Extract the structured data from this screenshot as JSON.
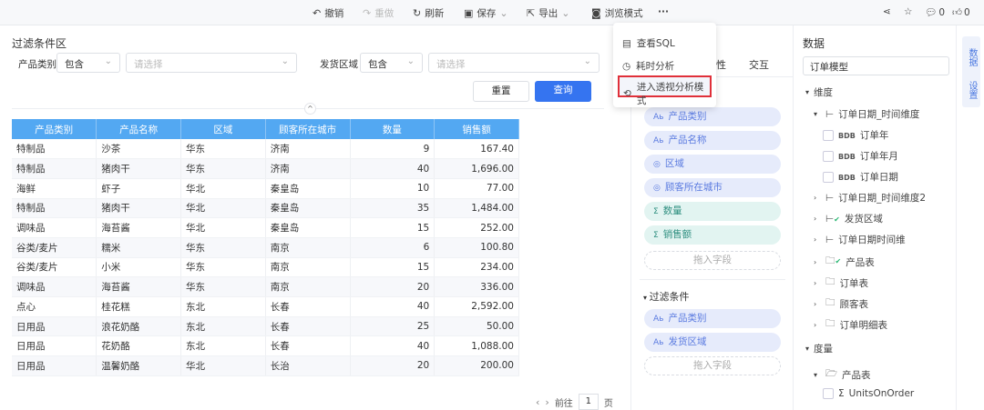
{
  "toolbar": {
    "undo": "撤销",
    "redo": "重做",
    "refresh": "刷新",
    "save": "保存",
    "export": "导出",
    "browse": "浏览模式",
    "more": "···",
    "comments": "0",
    "likes": "0"
  },
  "more_menu": {
    "items": [
      "查看SQL",
      "耗时分析",
      "进入透视分析模式"
    ]
  },
  "filter": {
    "title": "过滤条件区",
    "f1_label": "产品类别",
    "f1_op": "包含",
    "f1_placeholder": "请选择",
    "f2_label": "发货区域",
    "f2_op": "包含",
    "f2_placeholder": "请选择",
    "reset": "重置",
    "query": "查询"
  },
  "table": {
    "headers": [
      "产品类别",
      "产品名称",
      "区域",
      "顾客所在城市",
      "数量",
      "销售额"
    ],
    "rows": [
      [
        "特制品",
        "沙茶",
        "华东",
        "济南",
        "9",
        "167.40"
      ],
      [
        "特制品",
        "猪肉干",
        "华东",
        "济南",
        "40",
        "1,696.00"
      ],
      [
        "海鲜",
        "虾子",
        "华北",
        "秦皇岛",
        "10",
        "77.00"
      ],
      [
        "特制品",
        "猪肉干",
        "华北",
        "秦皇岛",
        "35",
        "1,484.00"
      ],
      [
        "调味品",
        "海苔酱",
        "华北",
        "秦皇岛",
        "15",
        "252.00"
      ],
      [
        "谷类/麦片",
        "糯米",
        "华东",
        "南京",
        "6",
        "100.80"
      ],
      [
        "谷类/麦片",
        "小米",
        "华东",
        "南京",
        "15",
        "234.00"
      ],
      [
        "调味品",
        "海苔酱",
        "华东",
        "南京",
        "20",
        "336.00"
      ],
      [
        "点心",
        "桂花糕",
        "东北",
        "长春",
        "40",
        "2,592.00"
      ],
      [
        "日用品",
        "浪花奶酪",
        "东北",
        "长春",
        "25",
        "50.00"
      ],
      [
        "日用品",
        "花奶酪",
        "东北",
        "长春",
        "40",
        "1,088.00"
      ],
      [
        "日用品",
        "温馨奶酪",
        "华北",
        "长治",
        "20",
        "200.00"
      ]
    ]
  },
  "pagination": {
    "goto": "前往",
    "page": "1",
    "unit": "页"
  },
  "middle": {
    "tab_partial": "性",
    "tab_interact": "交互",
    "fields": [
      "产品类别",
      "产品名称",
      "区域",
      "顾客所在城市",
      "数量",
      "销售额"
    ],
    "drop": "拖入字段",
    "filter_title": "过滤条件",
    "filter_fields": [
      "产品类别",
      "发货区域"
    ],
    "drop2": "拖入字段"
  },
  "data_panel": {
    "title": "数据",
    "model": "订单模型",
    "dimension": "维度",
    "measure": "度量",
    "dim_items": [
      "订单日期_时间维度",
      "订单年",
      "订单年月",
      "订单日期",
      "订单日期_时间维度2",
      "发货区域",
      "订单日期时间维",
      "产品表",
      "订单表",
      "顾客表",
      "订单明细表"
    ],
    "measure_items": [
      "产品表",
      "UnitsOnOrder"
    ]
  },
  "side_tabs": [
    "数据",
    "设置"
  ]
}
